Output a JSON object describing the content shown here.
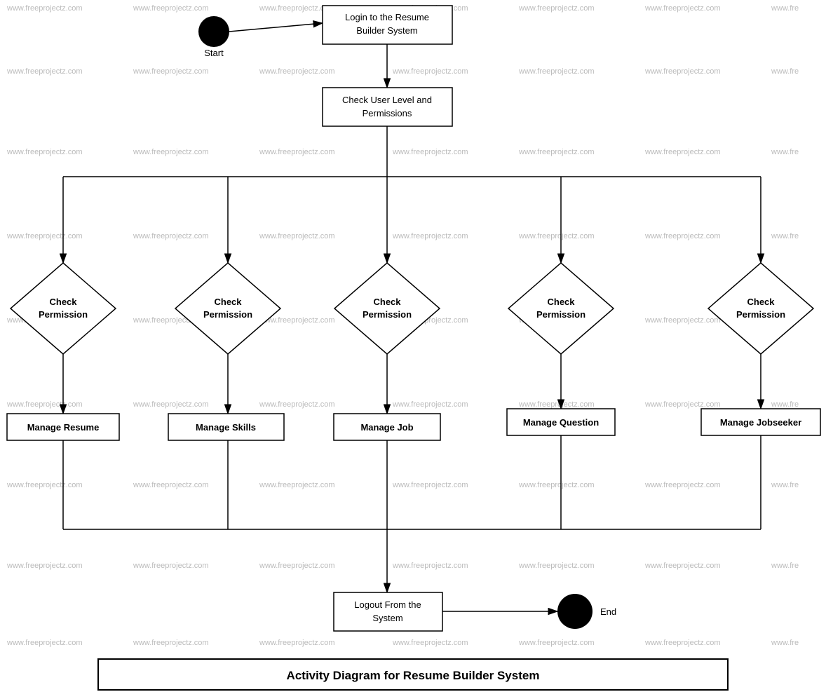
{
  "diagram": {
    "title": "Activity Diagram for Resume Builder System",
    "watermark": "www.freeprojectz.com",
    "nodes": {
      "start_label": "Start",
      "login": "Login to the Resume Builder System",
      "check_user": "Check User Level and Permissions",
      "check_perm1": "Check Permission",
      "check_perm2": "Check Permission",
      "check_perm3": "Check Permission",
      "check_perm4": "Check Permission",
      "check_perm5": "Check Permission",
      "manage_resume": "Manage Resume",
      "manage_skills": "Manage Skills",
      "manage_job": "Manage Job",
      "manage_question": "Manage Question",
      "manage_jobseeker": "Manage Jobseeker",
      "logout": "Logout From the System",
      "end_label": "End"
    },
    "colors": {
      "border": "#000000",
      "fill": "#ffffff",
      "text": "#000000"
    }
  }
}
